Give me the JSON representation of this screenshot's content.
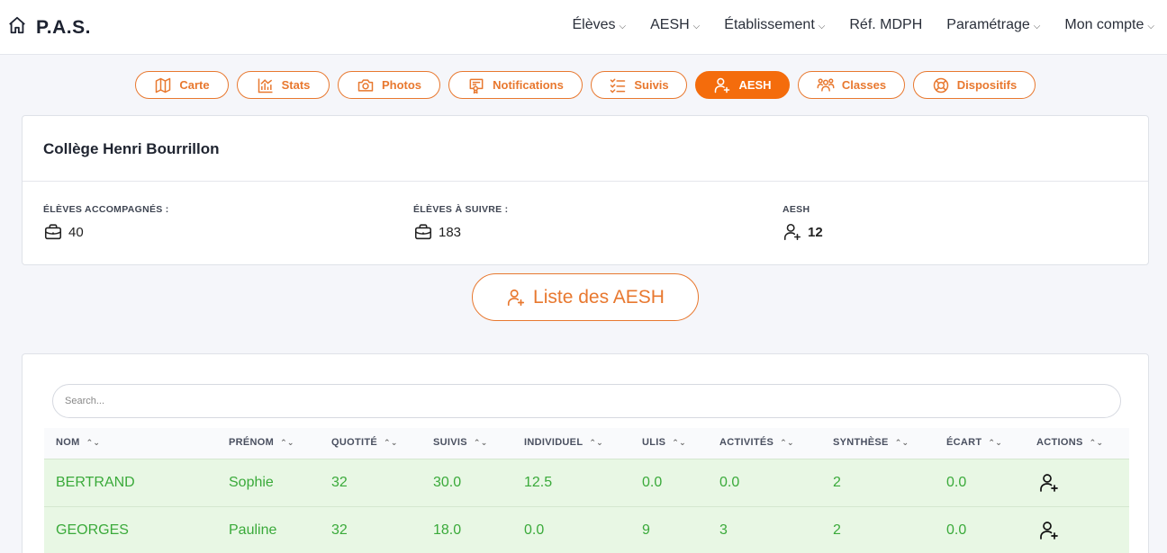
{
  "app": {
    "brand": "P.A.S."
  },
  "nav": [
    {
      "label": "Élèves"
    },
    {
      "label": "AESH"
    },
    {
      "label": "Établissement"
    },
    {
      "label": "Réf. MDPH"
    },
    {
      "label": "Paramétrage"
    },
    {
      "label": "Mon compte"
    }
  ],
  "pills": [
    {
      "label": "Carte",
      "icon": "map-icon"
    },
    {
      "label": "Stats",
      "icon": "chart-icon"
    },
    {
      "label": "Photos",
      "icon": "camera-icon"
    },
    {
      "label": "Notifications",
      "icon": "certificate-icon"
    },
    {
      "label": "Suivis",
      "icon": "checklist-icon"
    },
    {
      "label": "AESH",
      "icon": "user-plus-icon",
      "active": true
    },
    {
      "label": "Classes",
      "icon": "users-icon"
    },
    {
      "label": "Dispositifs",
      "icon": "lifebuoy-icon"
    }
  ],
  "school": {
    "name": "Collège Henri Bourrillon",
    "stats": [
      {
        "label": "ÉLÈVES ACCOMPAGNÉS :",
        "value": "40",
        "icon": "briefcase-icon"
      },
      {
        "label": "ÉLÈVES À SUIVRE :",
        "value": "183",
        "icon": "briefcase-icon"
      },
      {
        "label": "AESH",
        "value": "12",
        "icon": "user-plus-icon"
      }
    ]
  },
  "list_button": {
    "label": "Liste des AESH"
  },
  "table": {
    "search_placeholder": "Search...",
    "columns": [
      "NOM",
      "PRÉNOM",
      "QUOTITÉ",
      "SUIVIS",
      "INDIVIDUEL",
      "ULIS",
      "ACTIVITÉS",
      "SYNTHÈSE",
      "ÉCART",
      "ACTIONS"
    ],
    "rows": [
      {
        "nom": "BERTRAND",
        "prenom": "Sophie",
        "quotite": "32",
        "suivis": "30.0",
        "individuel": "12.5",
        "ulis": "0.0",
        "activites": "0.0",
        "synthese": "2",
        "ecart": "0.0"
      },
      {
        "nom": "GEORGES",
        "prenom": "Pauline",
        "quotite": "32",
        "suivis": "18.0",
        "individuel": "0.0",
        "ulis": "9",
        "activites": "3",
        "synthese": "2",
        "ecart": "0.0"
      }
    ]
  },
  "colors": {
    "accent": "#f46c0c",
    "row_bg": "#e8f7e4",
    "row_text": "#3aaa3a"
  }
}
